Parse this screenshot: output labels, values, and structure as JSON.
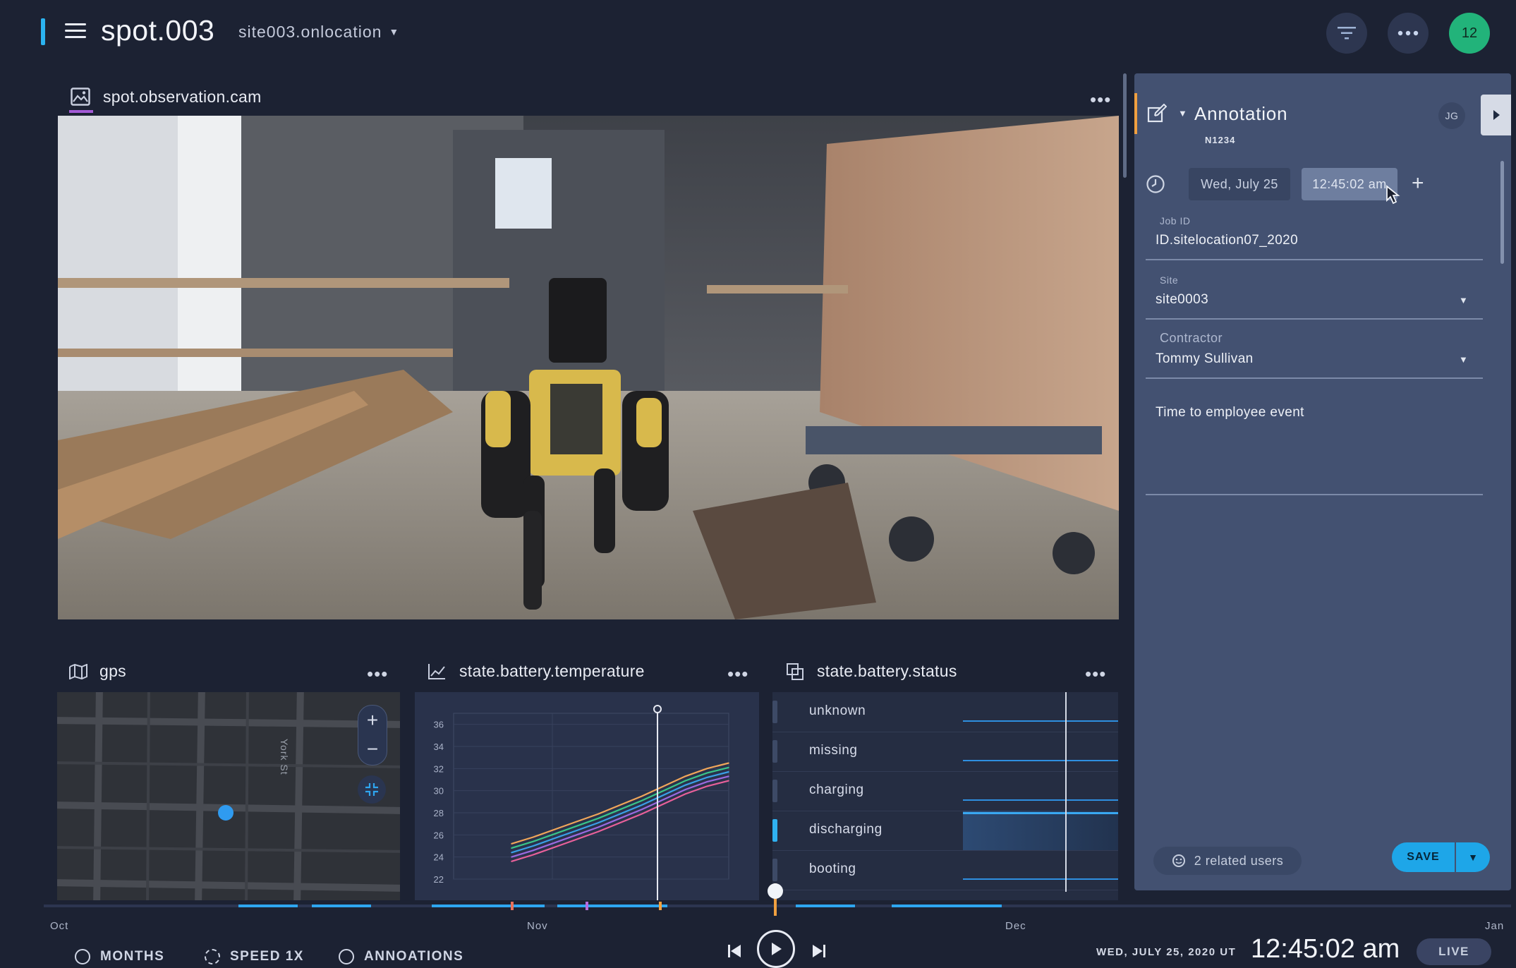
{
  "header": {
    "title": "spot.003",
    "site": "site003.onlocation",
    "avatar_count": "12"
  },
  "camera": {
    "title": "spot.observation.cam"
  },
  "gps": {
    "title": "gps",
    "street_label": "York St",
    "zoom_in": "+",
    "zoom_out": "−"
  },
  "temperature": {
    "title": "state.battery.temperature"
  },
  "status": {
    "title": "state.battery.status",
    "rows": [
      {
        "label": "unknown",
        "active": false
      },
      {
        "label": "missing",
        "active": false
      },
      {
        "label": "charging",
        "active": false
      },
      {
        "label": "discharging",
        "active": true
      },
      {
        "label": "booting",
        "active": false
      }
    ]
  },
  "chart_data": {
    "type": "line",
    "title": "state.battery.temperature",
    "xlabel": "",
    "ylabel": "",
    "y_ticks": [
      36,
      34,
      32,
      30,
      28,
      26,
      24,
      22
    ],
    "ylim": [
      22,
      37
    ],
    "x": [
      0,
      1,
      2,
      3,
      4,
      5,
      6,
      7,
      8,
      9,
      10
    ],
    "grid": true,
    "series": [
      {
        "color": "#f0a65a",
        "values": [
          25.2,
          25.8,
          26.5,
          27.2,
          27.9,
          28.7,
          29.5,
          30.4,
          31.3,
          32.0,
          32.5
        ]
      },
      {
        "color": "#39c58a",
        "values": [
          24.8,
          25.4,
          26.1,
          26.8,
          27.5,
          28.3,
          29.1,
          30.0,
          30.9,
          31.6,
          32.1
        ]
      },
      {
        "color": "#3aa0e8",
        "values": [
          24.4,
          25.0,
          25.7,
          26.4,
          27.1,
          27.9,
          28.7,
          29.6,
          30.5,
          31.2,
          31.7
        ]
      },
      {
        "color": "#9a6ae0",
        "values": [
          24.0,
          24.6,
          25.3,
          26.0,
          26.7,
          27.5,
          28.3,
          29.2,
          30.1,
          30.8,
          31.3
        ]
      },
      {
        "color": "#e8609a",
        "values": [
          23.6,
          24.2,
          24.9,
          25.6,
          26.3,
          27.1,
          27.9,
          28.8,
          29.7,
          30.4,
          30.9
        ]
      }
    ]
  },
  "annotation": {
    "title": "Annotation",
    "initials": "JG",
    "id": "N1234",
    "date": "Wed, July 25",
    "time": "12:45:02 am",
    "job_label": "Job ID",
    "job_value": "ID.sitelocation07_2020",
    "site_label": "Site",
    "site_value": "site0003",
    "contractor_label": "Contractor",
    "contractor_value": "Tommy Sullivan",
    "notes": "Time to employee event",
    "related": "2 related users",
    "save": "SAVE"
  },
  "timeline": {
    "months": [
      "Oct",
      "Nov",
      "Dec",
      "Jan"
    ],
    "btn_months": "MONTHS",
    "btn_speed": "SPEED 1X",
    "btn_annotations": "ANNOATIONS",
    "date": "WED, JULY 25, 2020 UT",
    "time": "12:45:02 am",
    "live": "LIVE"
  },
  "colors": {
    "accent": "#2bb3f0",
    "save": "#1ea6e8",
    "avatar": "#22b37a"
  }
}
